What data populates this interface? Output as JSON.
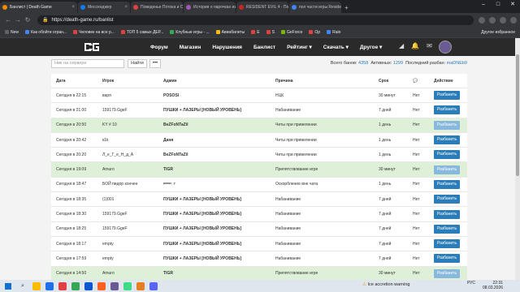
{
  "browser": {
    "tabs": [
      {
        "title": "Банлист | Death Game",
        "color": "#f08c00",
        "active": true
      },
      {
        "title": "Мессенджер",
        "color": "#1877f2"
      },
      {
        "title": "Поведенье Потока и Скриптов",
        "color": "#e04040"
      },
      {
        "title": "История о парочках из де...",
        "color": "#9b59b6"
      },
      {
        "title": "RESIDENT EVIL 4 - Полное П...",
        "color": "#cc2222"
      },
      {
        "title": "пол части игры Resident ne...",
        "color": "#4285f4"
      }
    ],
    "new_tab": "+",
    "url": "https://death-game.ru/banlist",
    "bookmarks": [
      {
        "label": "New",
        "color": "#5f6368"
      },
      {
        "label": "Как обойти огран...",
        "color": "#4285f4"
      },
      {
        "label": "Человек на все р...",
        "color": "#e04040"
      },
      {
        "label": "ТОП 5 самых ДЕР...",
        "color": "#e04040"
      },
      {
        "label": "Клубные игры - ...",
        "color": "#34a853"
      },
      {
        "label": "Авиабилеты",
        "color": "#fbbc05"
      },
      {
        "label": "E",
        "color": "#e04040"
      },
      {
        "label": "S",
        "color": "#e04040"
      },
      {
        "label": "GeForce",
        "color": "#76b900"
      },
      {
        "label": "Op",
        "color": "#e04040"
      },
      {
        "label": "Rain",
        "color": "#4285f4"
      }
    ],
    "bookmarks_other": "Другое избранное",
    "window_controls": [
      "–",
      "□",
      "✕"
    ]
  },
  "site": {
    "menu": [
      "Форум",
      "Магазин",
      "Нарушения",
      "Банлист",
      "Рейтинг ▾",
      "Скачать ▾",
      "Другое ▾"
    ],
    "search_placeholder": "Ник на сервере",
    "find_label": "Найти",
    "more_label": "•••",
    "stats": {
      "total_label": "Всего банов:",
      "total": "4358",
      "active_label": "Активных:",
      "active": "1299",
      "last_label": "Последний разбан:",
      "last": "maDNEb9"
    },
    "columns": [
      "Дата",
      "Игрок",
      "Админ",
      "Причина",
      "Срок",
      "💬",
      "Действие"
    ],
    "unban_label": "Разбанить",
    "rows": [
      {
        "date": "Сегодня в 22:15",
        "player": "варя",
        "admin": "POSOSI",
        "reason": "НЦК",
        "term": "30 минут",
        "chat": "Нет",
        "green": false,
        "disabled": false
      },
      {
        "date": "Сегодня в 21:00",
        "player": "159179.GgeF",
        "admin": "ПУШКИ + ЛАЗЕРЫ [НОВЫЙ УРОВЕНЬ]",
        "reason": "Набанивание",
        "term": "7 дней",
        "chat": "Нет",
        "green": false,
        "disabled": false
      },
      {
        "date": "Сегодня в 20:50",
        "player": "KY # 10",
        "admin": "BeZFoNTaZiI",
        "reason": "Читы при привелении",
        "term": "1 день",
        "chat": "Нет",
        "green": true,
        "disabled": true
      },
      {
        "date": "Сегодня в 20:42",
        "player": "к1k",
        "admin": "Даня",
        "reason": "Читы при привелении",
        "term": "1 день",
        "chat": "Нет",
        "green": false,
        "disabled": false
      },
      {
        "date": "Сегодня в 20:20",
        "player": "Л_е_Г_е_Н_д_А",
        "admin": "BeZFoNTaZiI",
        "reason": "Читы при привелении",
        "term": "1 день",
        "chat": "Нет",
        "green": false,
        "disabled": false
      },
      {
        "date": "Сегодня в 19:09",
        "player": "Amuro",
        "admin": "TIGR",
        "reason": "Препятствование игре",
        "term": "30 минут",
        "chat": "Нет",
        "green": true,
        "disabled": true
      },
      {
        "date": "Сегодня в 18:47",
        "player": "БОЙ пидор кончен",
        "admin": "ᵖᵒᵐᵉʳ◌ʸ",
        "reason": "Оскорбление вне чата",
        "term": "1 день",
        "chat": "Нет",
        "green": false,
        "disabled": false
      },
      {
        "date": "Сегодня в 18:35",
        "player": "(1)001",
        "admin": "ПУШКИ + ЛАЗЕРЫ [НОВЫЙ УРОВЕНЬ]",
        "reason": "Набанивание",
        "term": "7 дней",
        "chat": "Нет",
        "green": false,
        "disabled": false
      },
      {
        "date": "Сегодня в 18:30",
        "player": "159179.GgeF",
        "admin": "ПУШКИ + ЛАЗЕРЫ [НОВЫЙ УРОВЕНЬ]",
        "reason": "Набанивание",
        "term": "7 дней",
        "chat": "Нет",
        "green": false,
        "disabled": false
      },
      {
        "date": "Сегодня в 18:25",
        "player": "159179.GgeF",
        "admin": "ПУШКИ + ЛАЗЕРЫ [НОВЫЙ УРОВЕНЬ]",
        "reason": "Набанивание",
        "term": "7 дней",
        "chat": "Нет",
        "green": false,
        "disabled": false
      },
      {
        "date": "Сегодня в 18:17",
        "player": "empty",
        "admin": "ПУШКИ + ЛАЗЕРЫ [НОВЫЙ УРОВЕНЬ]",
        "reason": "Набанивание",
        "term": "7 дней",
        "chat": "Нет",
        "green": false,
        "disabled": false
      },
      {
        "date": "Сегодня в 17:59",
        "player": "empty",
        "admin": "ПУШКИ + ЛАЗЕРЫ [НОВЫЙ УРОВЕНЬ]",
        "reason": "Набанивание",
        "term": "7 дней",
        "chat": "Нет",
        "green": false,
        "disabled": false
      },
      {
        "date": "Сегодня в 14:50",
        "player": "Amuro",
        "admin": "TIGR",
        "reason": "Препятствование игре",
        "term": "30 минут",
        "chat": "Нет",
        "green": true,
        "disabled": true
      }
    ]
  },
  "taskbar": {
    "notification": "Ice accretion warning",
    "lang": "РУС",
    "time": "22:31",
    "date": "08.03.2026",
    "app_colors": [
      "#fbbc05",
      "#1f6feb",
      "#e04040",
      "#34a853",
      "#0b57d0",
      "#ff5f1f",
      "#6b5b95",
      "#3ddc84",
      "#e67e22",
      "#5865f2"
    ]
  }
}
